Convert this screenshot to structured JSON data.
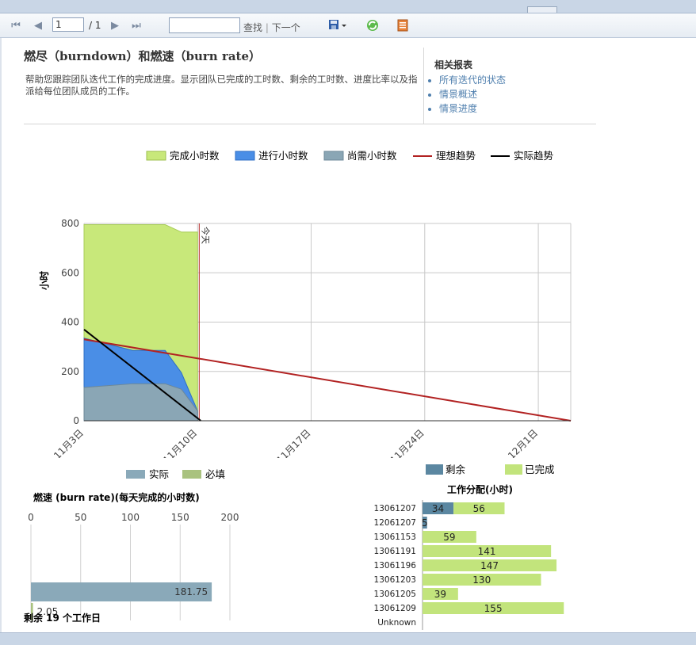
{
  "toolbar": {
    "page_value": "1",
    "page_total": "/ 1",
    "find_label": "查找",
    "next_label": "下一个",
    "find_value": ""
  },
  "report": {
    "title": "燃尽（burndown）和燃速（burn rate）",
    "description": "帮助您跟踪团队迭代工作的完成进度。显示团队已完成的工时数、剩余的工时数、进度比率以及指派给每位团队成员的工作。",
    "related_heading": "相关报表",
    "related_links": [
      "所有迭代的状态",
      "情景概述",
      "情景进度"
    ]
  },
  "colors": {
    "completed": "#c8e87a",
    "in_progress": "#4a8ee6",
    "remaining": "#8aa6b5",
    "ideal": "#b22222",
    "actual": "#000000",
    "burn_actual": "#8aa9b9",
    "burn_required": "#a9c27f",
    "work_remaining": "#5b87a1",
    "work_completed": "#c2e47c"
  },
  "chart_data": [
    {
      "type": "area",
      "ylabel": "小时",
      "xlabel": "",
      "ylim": [
        0,
        800
      ],
      "yticks": [
        0,
        200,
        400,
        600,
        800
      ],
      "xticks": [
        "11月3日",
        "11月10日",
        "11月17日",
        "11月24日",
        "12月1日"
      ],
      "today_marker_label": "今天",
      "legend": [
        "完成小时数",
        "进行小时数",
        "尚需小时数",
        "理想趋势",
        "实际趋势"
      ],
      "x_day": [
        0,
        3,
        4,
        5,
        6,
        7
      ],
      "series": [
        {
          "name": "尚需小时数",
          "values": [
            135,
            150,
            150,
            150,
            128,
            40
          ]
        },
        {
          "name": "进行小时数",
          "values": [
            335,
            285,
            285,
            285,
            195,
            40
          ]
        },
        {
          "name": "完成小时数",
          "values": [
            795,
            795,
            795,
            795,
            765,
            765
          ]
        }
      ],
      "ideal_trend": {
        "name": "理想趋势",
        "x_day": [
          0,
          30
        ],
        "values": [
          330,
          0
        ]
      },
      "actual_trend": {
        "name": "实际趋势",
        "x_day": [
          0,
          7.2
        ],
        "values": [
          370,
          0
        ]
      },
      "today_day": 7.1
    },
    {
      "type": "bar",
      "title": "燃速 (burn rate)(每天完成的小时数)",
      "legend": [
        "实际",
        "必填"
      ],
      "xticks": [
        0,
        50,
        100,
        150,
        200
      ],
      "xlim": [
        0,
        200
      ],
      "categories": [
        "实际",
        "必填"
      ],
      "values": [
        181.75,
        2.05
      ],
      "footer": "剩余 19 个工作日"
    },
    {
      "type": "bar",
      "title": "工作分配(小时)",
      "legend": [
        "剩余",
        "已完成"
      ],
      "categories": [
        "13061207",
        "12061207",
        "13061153",
        "13061191",
        "13061196",
        "13061203",
        "13061205",
        "13061209",
        "Unknown"
      ],
      "series": [
        {
          "name": "剩余",
          "values": [
            34,
            5,
            0,
            0,
            0,
            0,
            0,
            0,
            0
          ]
        },
        {
          "name": "已完成",
          "values": [
            56,
            0,
            59,
            141,
            147,
            130,
            39,
            155,
            0
          ]
        }
      ]
    }
  ]
}
